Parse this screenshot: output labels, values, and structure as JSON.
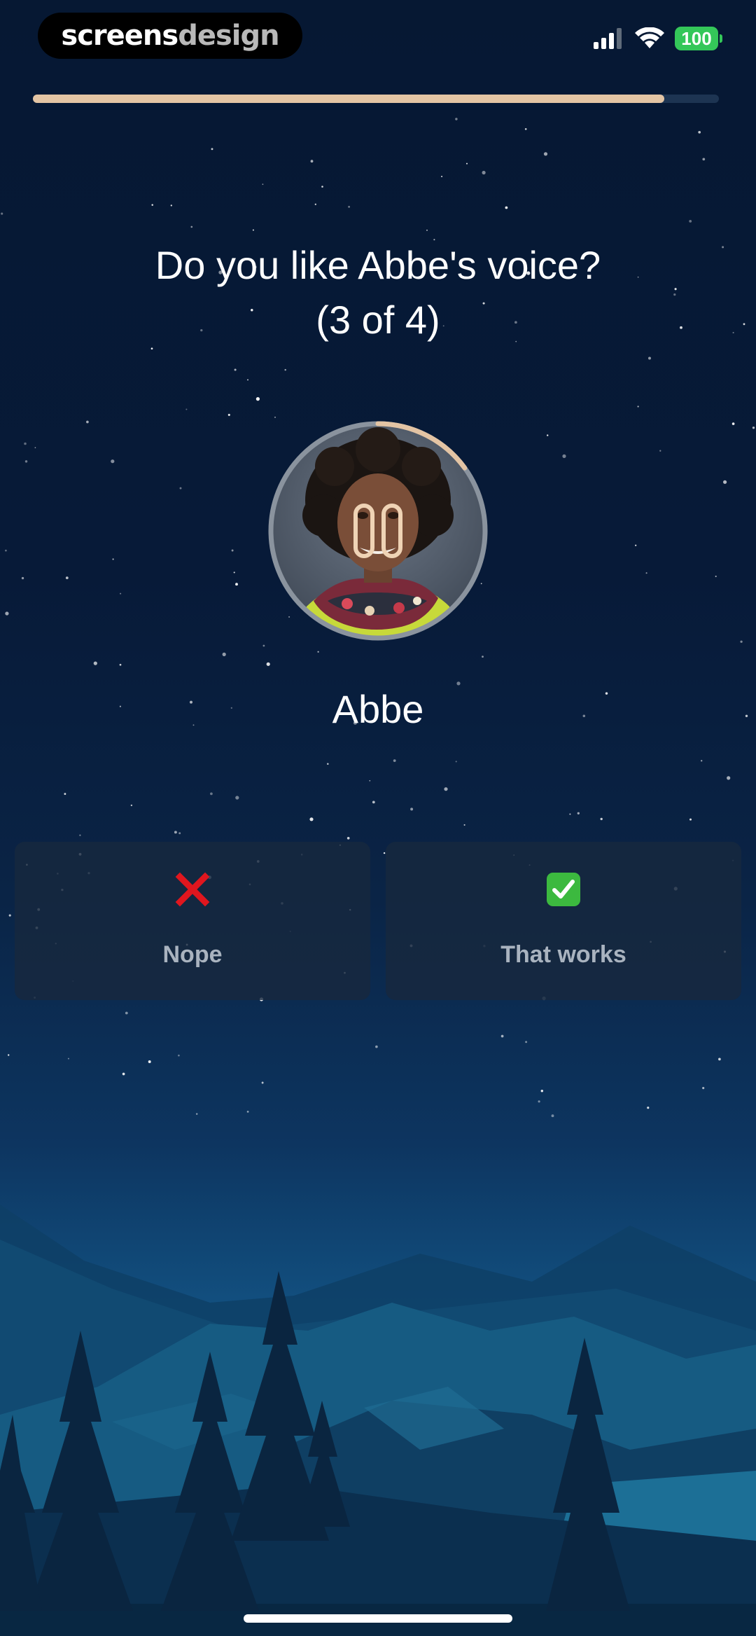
{
  "status_bar": {
    "brand_primary": "screens",
    "brand_secondary": "design",
    "battery": "100"
  },
  "progress": {
    "fraction": 0.92,
    "color": "#e3c4a4"
  },
  "question": {
    "line1": "Do you like Abbe's voice?",
    "line2": "(3 of 4)"
  },
  "voice": {
    "name": "Abbe",
    "playback_progress": 0.15,
    "control_icon": "pause-icon"
  },
  "choices": [
    {
      "label": "Nope",
      "icon": "cross-mark-icon",
      "icon_color": "#e0161e"
    },
    {
      "label": "That works",
      "icon": "check-box-icon",
      "icon_color": "#3cb93f"
    }
  ],
  "colors": {
    "background_top": "#061833",
    "accent": "#e3c4a4",
    "battery": "#34c759"
  }
}
